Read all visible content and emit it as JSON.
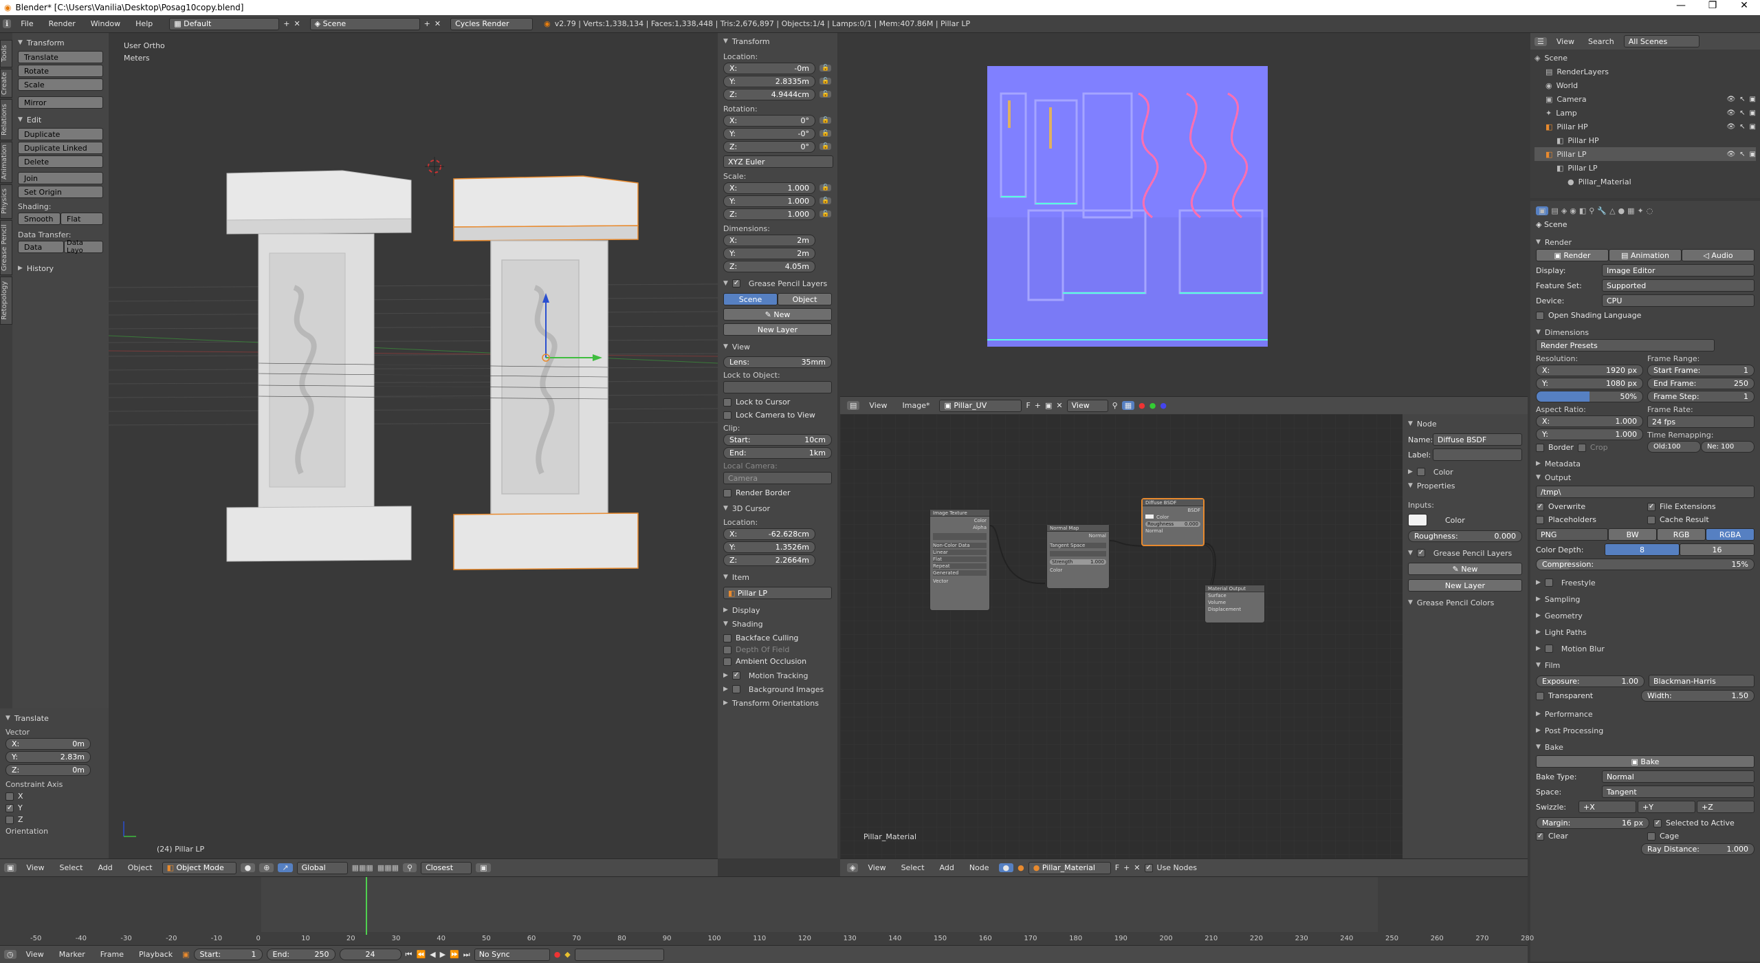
{
  "window": {
    "title": "Blender* [C:\\Users\\Vanilia\\Desktop\\Posag10copy.blend]",
    "min": "—",
    "max": "❐",
    "close": "✕"
  },
  "menubar": {
    "items": [
      "File",
      "Render",
      "Window",
      "Help"
    ],
    "layout": "Default",
    "scene": "Scene",
    "engine": "Cycles Render",
    "stats": "v2.79 | Verts:1,338,134 | Faces:1,338,448 | Tris:2,676,897 | Objects:1/4 | Lamps:0/1 | Mem:407.86M | Pillar LP"
  },
  "left_tabs": [
    "Tools",
    "Create",
    "Relations",
    "Animation",
    "Physics",
    "Grease Pencil",
    "Retopology"
  ],
  "toolshelf": {
    "transform_header": "Transform",
    "transform_buttons": [
      "Translate",
      "Rotate",
      "Scale"
    ],
    "mirror": "Mirror",
    "edit_header": "Edit",
    "edit_buttons": [
      "Duplicate",
      "Duplicate Linked",
      "Delete"
    ],
    "join": "Join",
    "set_origin": "Set Origin",
    "shading_label": "Shading:",
    "smooth": "Smooth",
    "flat": "Flat",
    "data_transfer_label": "Data Transfer:",
    "data": "Data",
    "data_layo": "Data Layo",
    "history": "History"
  },
  "operator_panel": {
    "header": "Translate",
    "vector_label": "Vector",
    "x_label": "X:",
    "x": "0m",
    "y_label": "Y:",
    "y": "2.83m",
    "z_label": "Z:",
    "z": "0m",
    "constraint_label": "Constraint Axis",
    "axes": [
      "X",
      "Y",
      "Z"
    ],
    "orientation_label": "Orientation"
  },
  "viewport": {
    "view_name": "User Ortho",
    "units": "Meters",
    "object_label": "(24) Pillar LP",
    "header": {
      "menus": [
        "View",
        "Select",
        "Add",
        "Object"
      ],
      "mode": "Object Mode",
      "pivot": "Global",
      "snap": "Closest"
    }
  },
  "n_panel": {
    "transform_header": "Transform",
    "location_label": "Location:",
    "loc": [
      {
        "a": "X:",
        "v": "-0m"
      },
      {
        "a": "Y:",
        "v": "2.8335m"
      },
      {
        "a": "Z:",
        "v": "4.9444cm"
      }
    ],
    "rotation_label": "Rotation:",
    "rot": [
      {
        "a": "X:",
        "v": "0°"
      },
      {
        "a": "Y:",
        "v": "-0°"
      },
      {
        "a": "Z:",
        "v": "0°"
      }
    ],
    "rot_mode": "XYZ Euler",
    "scale_label": "Scale:",
    "scale": [
      {
        "a": "X:",
        "v": "1.000"
      },
      {
        "a": "Y:",
        "v": "1.000"
      },
      {
        "a": "Z:",
        "v": "1.000"
      }
    ],
    "dimensions_label": "Dimensions:",
    "dim": [
      {
        "a": "X:",
        "v": "2m"
      },
      {
        "a": "Y:",
        "v": "2m"
      },
      {
        "a": "Z:",
        "v": "4.05m"
      }
    ],
    "gp_header": "Grease Pencil Layers",
    "gp_scene": "Scene",
    "gp_object": "Object",
    "gp_new": "New",
    "gp_new_layer": "New Layer",
    "view_header": "View",
    "lens_label": "Lens:",
    "lens": "35mm",
    "lock_object_label": "Lock to Object:",
    "lock_cursor": "Lock to Cursor",
    "lock_camera": "Lock Camera to View",
    "clip_label": "Clip:",
    "clip_start_label": "Start:",
    "clip_start": "10cm",
    "clip_end_label": "End:",
    "clip_end": "1km",
    "local_camera": "Local Camera:",
    "camera": "Camera",
    "render_border": "Render Border",
    "cursor_header": "3D Cursor",
    "cursor_location_label": "Location:",
    "cursor": [
      {
        "a": "X:",
        "v": "-62.628cm"
      },
      {
        "a": "Y:",
        "v": "1.3526m"
      },
      {
        "a": "Z:",
        "v": "2.2664m"
      }
    ],
    "item_header": "Item",
    "item_name": "Pillar LP",
    "display_header": "Display",
    "shading_header": "Shading",
    "backface": "Backface Culling",
    "dof": "Depth Of Field",
    "ao": "Ambient Occlusion",
    "motion_tracking": "Motion Tracking",
    "bg_images": "Background Images",
    "transform_orient": "Transform Orientations"
  },
  "image_editor": {
    "menus": [
      "View",
      "Image*"
    ],
    "image_name": "Pillar_UV",
    "view": "View"
  },
  "node_editor": {
    "material_label": "Pillar_Material",
    "menus": [
      "View",
      "Select",
      "Add",
      "Node"
    ],
    "material": "Pillar_Material",
    "use_nodes": "Use Nodes",
    "nodes": {
      "image_texture": "Image Texture",
      "normal_map": "Normal Map",
      "diffuse": "Diffuse BSDF",
      "output": "Material Output",
      "tangent": "Tangent Space",
      "strength": "Strength",
      "strength_val": "1.000",
      "roughness": "Roughness",
      "roughness_val": "0.000",
      "color": "Color",
      "alpha": "Alpha",
      "normal": "Normal",
      "bsdf": "BSDF",
      "surface": "Surface",
      "volume": "Volume",
      "displacement": "Displacement",
      "img_opts": [
        "Non-Color Data",
        "Linear",
        "Flat",
        "Repeat",
        "Generated",
        "Vector"
      ]
    }
  },
  "node_sidebar": {
    "node_header": "Node",
    "name_label": "Name:",
    "name": "Diffuse BSDF",
    "label_label": "Label:",
    "color_header": "Color",
    "properties_header": "Properties",
    "inputs_label": "Inputs:",
    "color_label": "Color",
    "roughness_label": "Roughness:",
    "roughness": "0.000",
    "gp_header": "Grease Pencil Layers",
    "new": "New",
    "new_layer": "New Layer",
    "gp_colors": "Grease Pencil Colors"
  },
  "outliner": {
    "menus": [
      "View",
      "Search"
    ],
    "scenes": "All Scenes",
    "items": [
      {
        "name": "Scene",
        "indent": 0
      },
      {
        "name": "RenderLayers",
        "indent": 1
      },
      {
        "name": "World",
        "indent": 1
      },
      {
        "name": "Camera",
        "indent": 1
      },
      {
        "name": "Lamp",
        "indent": 1
      },
      {
        "name": "Pillar HP",
        "indent": 1
      },
      {
        "name": "Pillar HP",
        "indent": 2
      },
      {
        "name": "Pillar LP",
        "indent": 1
      },
      {
        "name": "Pillar LP",
        "indent": 2
      },
      {
        "name": "Pillar_Material",
        "indent": 3
      }
    ]
  },
  "properties": {
    "scene": "Scene",
    "render_header": "Render",
    "render_btn": "Render",
    "animation_btn": "Animation",
    "audio_btn": "Audio",
    "display_label": "Display:",
    "display": "Image Editor",
    "feature_label": "Feature Set:",
    "feature": "Supported",
    "device_label": "Device:",
    "device": "CPU",
    "osl": "Open Shading Language",
    "dimensions_header": "Dimensions",
    "presets": "Render Presets",
    "resolution_label": "Resolution:",
    "res_x": "1920 px",
    "res_y": "1080 px",
    "res_pct": "50%",
    "frame_range_label": "Frame Range:",
    "start_frame": "Start Frame:",
    "start_frame_v": "1",
    "end_frame": "End Frame:",
    "end_frame_v": "250",
    "frame_step": "Frame Step:",
    "frame_step_v": "1",
    "aspect_label": "Aspect Ratio:",
    "asp_x": "1.000",
    "asp_y": "1.000",
    "frame_rate_label": "Frame Rate:",
    "frame_rate": "24 fps",
    "border": "Border",
    "crop": "Crop",
    "time_remap": "Time Remapping:",
    "old": "Old:100",
    "new": "Ne: 100",
    "metadata_header": "Metadata",
    "output_header": "Output",
    "output_path": "/tmp\\",
    "overwrite": "Overwrite",
    "file_ext": "File Extensions",
    "placeholders": "Placeholders",
    "cache_result": "Cache Result",
    "format": "PNG",
    "bw": "BW",
    "rgb": "RGB",
    "rgba": "RGBA",
    "color_depth_label": "Color Depth:",
    "depth8": "8",
    "depth16": "16",
    "compression": "Compression:",
    "compression_v": "15%",
    "freestyle": "Freestyle",
    "sampling": "Sampling",
    "geometry": "Geometry",
    "light_paths": "Light Paths",
    "motion_blur": "Motion Blur",
    "film_header": "Film",
    "exposure": "Exposure:",
    "exposure_v": "1.00",
    "filter": "Blackman-Harris",
    "transparent": "Transparent",
    "width": "Width:",
    "width_v": "1.50",
    "performance": "Performance",
    "post_processing": "Post Processing",
    "bake_header": "Bake",
    "bake_btn": "Bake",
    "bake_type_label": "Bake Type:",
    "bake_type": "Normal",
    "space_label": "Space:",
    "space": "Tangent",
    "swizzle_label": "Swizzle:",
    "swz_x": "+X",
    "swz_y": "+Y",
    "swz_z": "+Z",
    "margin_label": "Margin:",
    "margin_v": "16 px",
    "selected_active": "Selected to Active",
    "clear": "Clear",
    "cage": "Cage",
    "ray_distance": "Ray Distance:",
    "ray_distance_v": "1.000"
  },
  "timeline": {
    "ticks": [
      "-50",
      "-40",
      "-30",
      "-20",
      "-10",
      "0",
      "10",
      "20",
      "30",
      "40",
      "50",
      "60",
      "70",
      "80",
      "90",
      "100",
      "110",
      "120",
      "130",
      "140",
      "150",
      "160",
      "170",
      "180",
      "190",
      "200",
      "210",
      "220",
      "230",
      "240",
      "250",
      "260",
      "270",
      "280"
    ],
    "current_frame": 24,
    "menus": [
      "View",
      "Marker",
      "Frame",
      "Playback"
    ],
    "start_label": "Start:",
    "start": "1",
    "end_label": "End:",
    "end": "250",
    "frame": "24",
    "sync": "No Sync"
  },
  "colors": {
    "accent": "#5680c2",
    "bg": "#393939",
    "panel": "#454545",
    "selected_outline": "#e88a2e"
  }
}
